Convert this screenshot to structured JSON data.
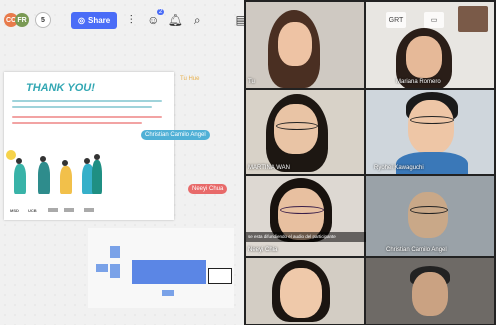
{
  "toolbar": {
    "avatars": [
      {
        "initials": "CC",
        "color": "#e87b4c"
      },
      {
        "initials": "FR",
        "color": "#7a9a54"
      }
    ],
    "avatar_count": "5",
    "share_label": "Share",
    "notification_count": "2"
  },
  "board": {
    "card_title": "THANK YOU!",
    "cursor_labels": [
      {
        "text": "Christian Camilo Angel",
        "color": "#4fb0d6"
      },
      {
        "text": "Neeyi Chua",
        "color": "#e86a6a"
      },
      {
        "text": "Tu Hue",
        "color": "#e7b04c"
      }
    ],
    "logos": [
      "MSD",
      "UCB",
      "",
      "",
      ""
    ]
  },
  "videos": {
    "participants": [
      {
        "name": "Tu"
      },
      {
        "name": "Mariana Romero"
      },
      {
        "name": "MARTINA WAN"
      },
      {
        "name": "Ryohei Kawaguchi"
      },
      {
        "name": "Neeyi Chia"
      },
      {
        "name": "Christian Camilo Angel"
      },
      {
        "name": ""
      },
      {
        "name": ""
      }
    ],
    "chat_message": "se esta difundiendo el audio del participante",
    "top_button_label": "GRT"
  },
  "colors": {
    "accent": "#4a6cf7",
    "teal": "#32a7b3"
  }
}
